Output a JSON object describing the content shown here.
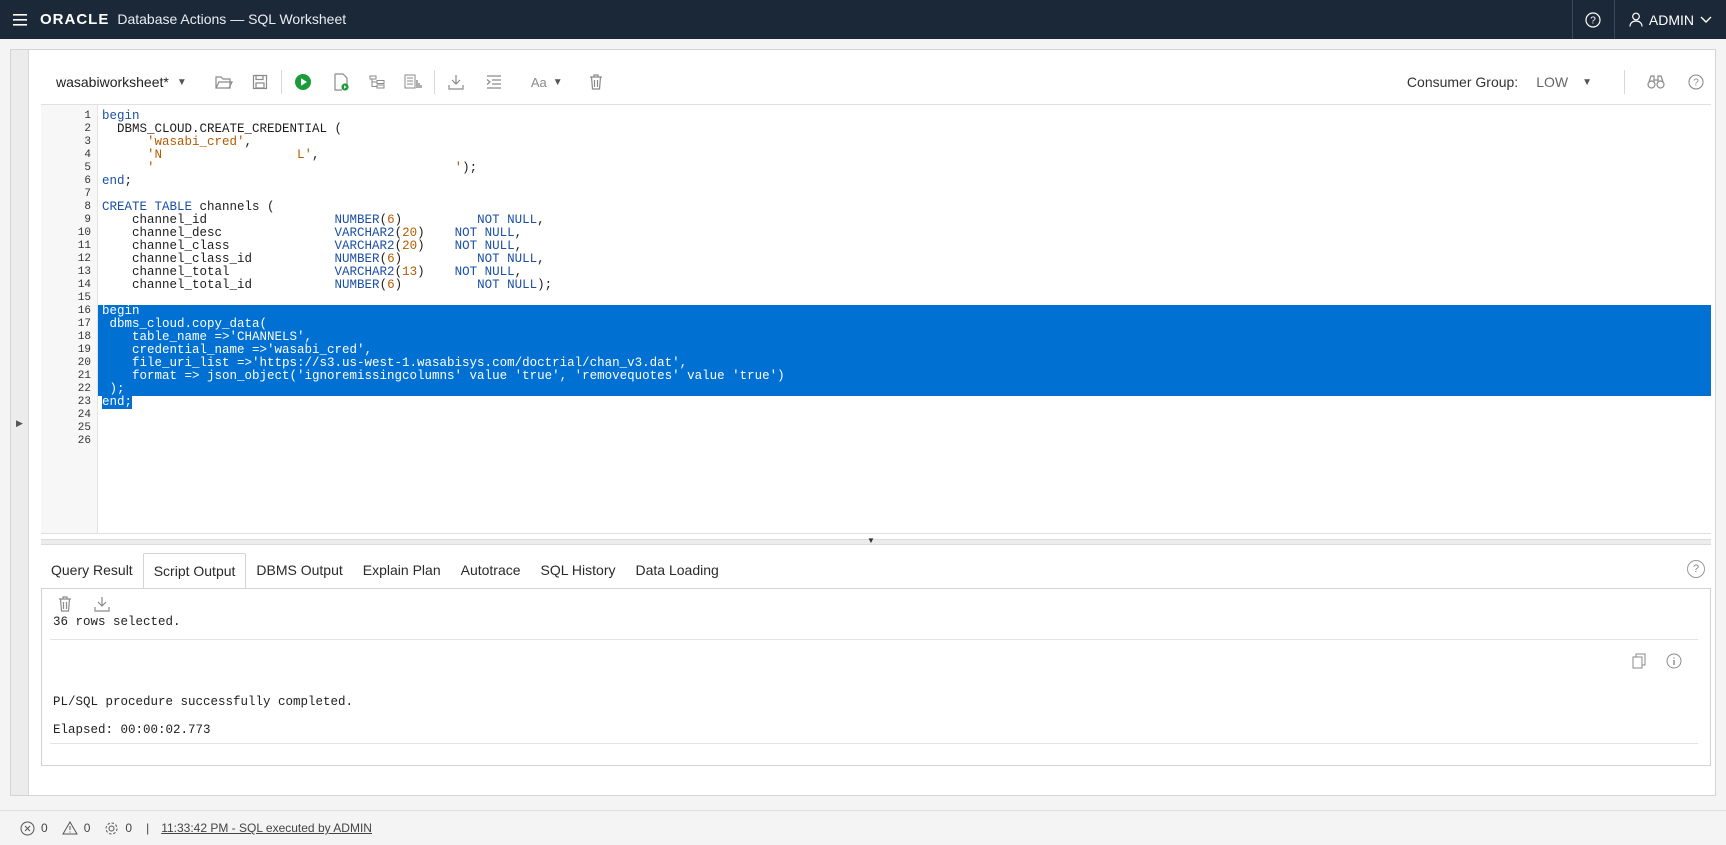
{
  "header": {
    "brand": "ORACLE",
    "title": "Database Actions — SQL Worksheet",
    "user": "ADMIN"
  },
  "toolbar": {
    "worksheet_name": "wasabiworksheet*",
    "consumer_group_label": "Consumer Group:",
    "consumer_group_value": "LOW"
  },
  "editor": {
    "lines": [
      {
        "n": "1",
        "parts": [
          {
            "c": "kw",
            "t": "begin"
          }
        ]
      },
      {
        "n": "2",
        "parts": [
          {
            "c": "plain",
            "t": "  DBMS_CLOUD.CREATE_CREDENTIAL ("
          }
        ]
      },
      {
        "n": "3",
        "parts": [
          {
            "c": "plain",
            "t": "      "
          },
          {
            "c": "str",
            "t": "'wasabi_cred'"
          },
          {
            "c": "plain",
            "t": ","
          }
        ]
      },
      {
        "n": "4",
        "parts": [
          {
            "c": "plain",
            "t": "      "
          },
          {
            "c": "str",
            "t": "'N                  L'"
          },
          {
            "c": "plain",
            "t": ","
          }
        ]
      },
      {
        "n": "5",
        "parts": [
          {
            "c": "plain",
            "t": "      "
          },
          {
            "c": "str",
            "t": "'                                        '"
          },
          {
            "c": "plain",
            "t": ");"
          }
        ]
      },
      {
        "n": "6",
        "parts": [
          {
            "c": "kw",
            "t": "end"
          },
          {
            "c": "plain",
            "t": ";"
          }
        ]
      },
      {
        "n": "7",
        "parts": []
      },
      {
        "n": "8",
        "parts": [
          {
            "c": "kw",
            "t": "CREATE TABLE"
          },
          {
            "c": "plain",
            "t": " channels ("
          }
        ]
      },
      {
        "n": "9",
        "parts": [
          {
            "c": "plain",
            "t": "    channel_id                 "
          },
          {
            "c": "kw",
            "t": "NUMBER"
          },
          {
            "c": "plain",
            "t": "("
          },
          {
            "c": "num",
            "t": "6"
          },
          {
            "c": "plain",
            "t": ")          "
          },
          {
            "c": "kw",
            "t": "NOT NULL"
          },
          {
            "c": "plain",
            "t": ","
          }
        ]
      },
      {
        "n": "10",
        "parts": [
          {
            "c": "plain",
            "t": "    channel_desc               "
          },
          {
            "c": "kw",
            "t": "VARCHAR2"
          },
          {
            "c": "plain",
            "t": "("
          },
          {
            "c": "num",
            "t": "20"
          },
          {
            "c": "plain",
            "t": ")    "
          },
          {
            "c": "kw",
            "t": "NOT NULL"
          },
          {
            "c": "plain",
            "t": ","
          }
        ]
      },
      {
        "n": "11",
        "parts": [
          {
            "c": "plain",
            "t": "    channel_class              "
          },
          {
            "c": "kw",
            "t": "VARCHAR2"
          },
          {
            "c": "plain",
            "t": "("
          },
          {
            "c": "num",
            "t": "20"
          },
          {
            "c": "plain",
            "t": ")    "
          },
          {
            "c": "kw",
            "t": "NOT NULL"
          },
          {
            "c": "plain",
            "t": ","
          }
        ]
      },
      {
        "n": "12",
        "parts": [
          {
            "c": "plain",
            "t": "    channel_class_id           "
          },
          {
            "c": "kw",
            "t": "NUMBER"
          },
          {
            "c": "plain",
            "t": "("
          },
          {
            "c": "num",
            "t": "6"
          },
          {
            "c": "plain",
            "t": ")          "
          },
          {
            "c": "kw",
            "t": "NOT NULL"
          },
          {
            "c": "plain",
            "t": ","
          }
        ]
      },
      {
        "n": "13",
        "parts": [
          {
            "c": "plain",
            "t": "    channel_total              "
          },
          {
            "c": "kw",
            "t": "VARCHAR2"
          },
          {
            "c": "plain",
            "t": "("
          },
          {
            "c": "num",
            "t": "13"
          },
          {
            "c": "plain",
            "t": ")    "
          },
          {
            "c": "kw",
            "t": "NOT NULL"
          },
          {
            "c": "plain",
            "t": ","
          }
        ]
      },
      {
        "n": "14",
        "parts": [
          {
            "c": "plain",
            "t": "    channel_total_id           "
          },
          {
            "c": "kw",
            "t": "NUMBER"
          },
          {
            "c": "plain",
            "t": "("
          },
          {
            "c": "num",
            "t": "6"
          },
          {
            "c": "plain",
            "t": ")          "
          },
          {
            "c": "kw",
            "t": "NOT NULL"
          },
          {
            "c": "plain",
            "t": ");"
          }
        ]
      },
      {
        "n": "15",
        "parts": []
      },
      {
        "n": "16",
        "sel": true,
        "parts": [
          {
            "c": "plain",
            "t": "begin"
          }
        ]
      },
      {
        "n": "17",
        "sel": true,
        "parts": [
          {
            "c": "plain",
            "t": " dbms_cloud.copy_data("
          }
        ]
      },
      {
        "n": "18",
        "sel": true,
        "parts": [
          {
            "c": "plain",
            "t": "    table_name =>'CHANNELS',"
          }
        ]
      },
      {
        "n": "19",
        "sel": true,
        "parts": [
          {
            "c": "plain",
            "t": "    credential_name =>'wasabi_cred',"
          }
        ]
      },
      {
        "n": "20",
        "sel": true,
        "parts": [
          {
            "c": "plain",
            "t": "    file_uri_list =>'https://s3.us-west-1.wasabisys.com/doctrial/chan_v3.dat',"
          }
        ]
      },
      {
        "n": "21",
        "sel": true,
        "parts": [
          {
            "c": "plain",
            "t": "    format => json_object('ignoremissingcolumns' value 'true', 'removequotes' value 'true')"
          }
        ]
      },
      {
        "n": "22",
        "sel": true,
        "parts": [
          {
            "c": "plain",
            "t": " );"
          }
        ]
      },
      {
        "n": "23",
        "sel": true,
        "partial": true,
        "parts": [
          {
            "c": "plain",
            "t": "end;"
          }
        ]
      },
      {
        "n": "24",
        "parts": []
      },
      {
        "n": "25",
        "parts": []
      },
      {
        "n": "26",
        "parts": []
      }
    ]
  },
  "tabs": [
    "Query Result",
    "Script Output",
    "DBMS Output",
    "Explain Plan",
    "Autotrace",
    "SQL History",
    "Data Loading"
  ],
  "active_tab": "Script Output",
  "output": {
    "clipped_line": "36 rows selected.",
    "line1": "PL/SQL procedure successfully completed.",
    "line2": "Elapsed: 00:00:02.773"
  },
  "status": {
    "errors": "0",
    "warnings": "0",
    "tasks": "0",
    "separator": "|",
    "message": "11:33:42 PM - SQL executed by ADMIN"
  }
}
